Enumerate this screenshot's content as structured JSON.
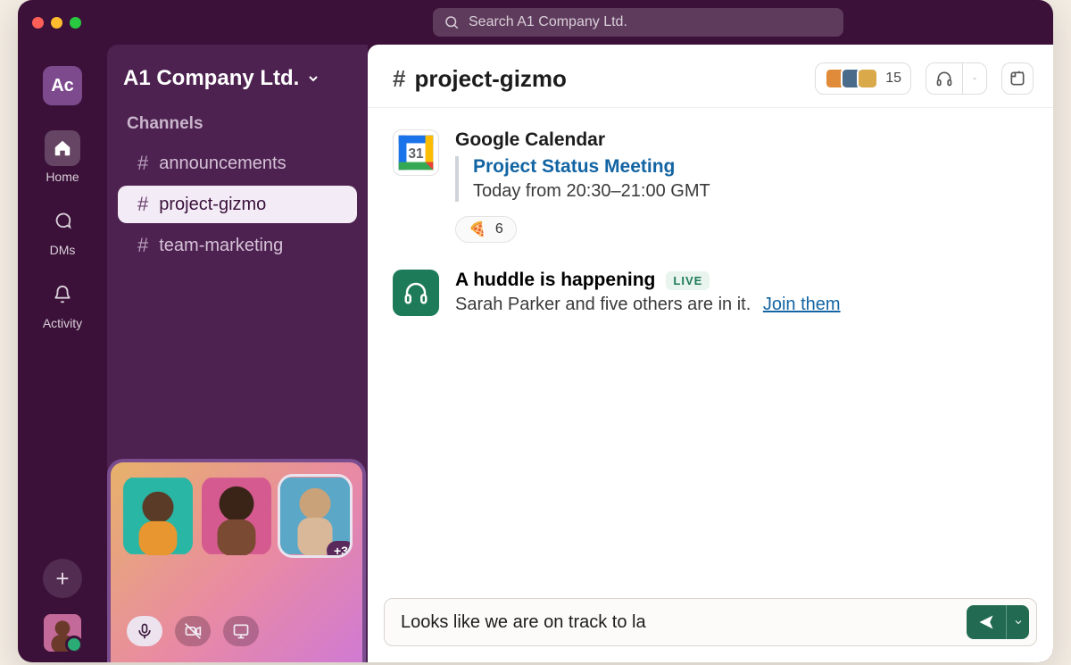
{
  "search": {
    "placeholder": "Search A1 Company Ltd."
  },
  "workspace": {
    "badge": "Ac",
    "name": "A1 Company Ltd."
  },
  "rail": {
    "home": "Home",
    "dms": "DMs",
    "activity": "Activity"
  },
  "sidebar": {
    "section_label": "Channels",
    "channels": [
      {
        "name": "announcements",
        "active": false
      },
      {
        "name": "project-gizmo",
        "active": true
      },
      {
        "name": "team-marketing",
        "active": false
      }
    ]
  },
  "huddle_dock": {
    "overflow_label": "+3"
  },
  "channel_header": {
    "name": "project-gizmo",
    "member_count": "15"
  },
  "messages": {
    "gcal": {
      "app_name": "Google Calendar",
      "event_title": "Project Status Meeting",
      "event_time": "Today from 20:30–21:00 GMT",
      "calendar_day": "31",
      "reaction_count": "6"
    },
    "huddle": {
      "title": "A huddle is happening",
      "live_badge": "LIVE",
      "subtitle": "Sarah Parker and five others are in it.",
      "join_label": "Join them"
    }
  },
  "composer": {
    "text": "Looks like we are on track to la"
  }
}
